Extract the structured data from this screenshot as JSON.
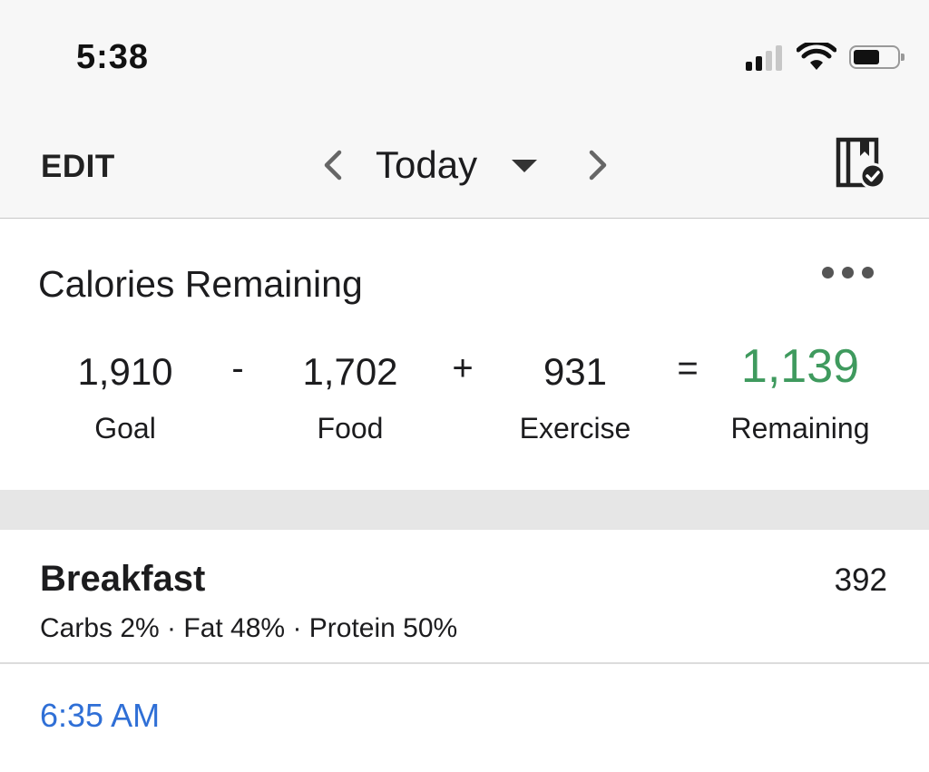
{
  "status_bar": {
    "time": "5:38",
    "signal_bars_active": 2,
    "signal_bars_total": 4,
    "battery_level": 0.6,
    "icons": [
      "signal-icon",
      "wifi-icon",
      "battery-icon"
    ]
  },
  "nav": {
    "edit_label": "EDIT",
    "title": "Today",
    "icons": [
      "chevron-left-icon",
      "caret-down-icon",
      "chevron-right-icon",
      "diary-complete-icon"
    ]
  },
  "calories": {
    "title": "Calories Remaining",
    "goal_value": "1,910",
    "goal_label": "Goal",
    "minus": "-",
    "food_value": "1,702",
    "food_label": "Food",
    "plus": "+",
    "exercise_value": "931",
    "exercise_label": "Exercise",
    "equals": "=",
    "remaining_value": "1,139",
    "remaining_label": "Remaining",
    "remaining_color": "#3f9a5e"
  },
  "meal": {
    "title": "Breakfast",
    "calories": "392",
    "macros": "Carbs 2% · Fat 48% · Protein 50%",
    "entry_time": "6:35 AM",
    "time_color": "#2f6fd6"
  }
}
